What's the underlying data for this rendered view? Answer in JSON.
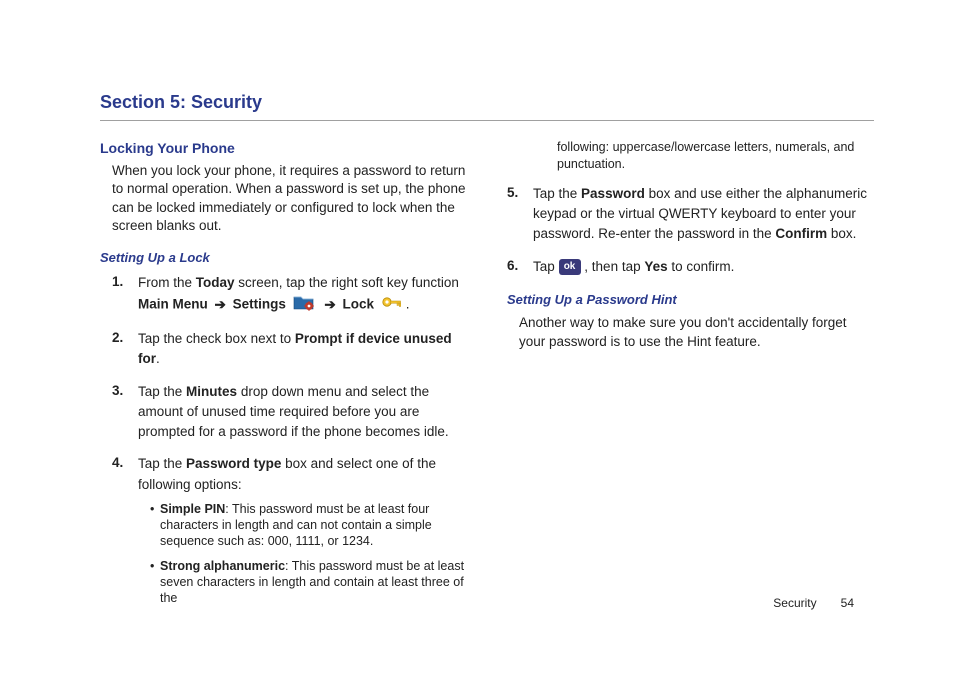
{
  "sectionTitle": "Section 5: Security",
  "footer": {
    "section": "Security",
    "page": "54"
  },
  "left": {
    "h2": "Locking Your Phone",
    "intro": "When you lock your phone, it requires a password to return to normal operation. When a password is set up, the phone can be locked immediately or configured to lock when the screen blanks out.",
    "h3": "Setting Up a Lock",
    "step1_a": "From the ",
    "step1_today": "Today",
    "step1_b": " screen, tap the right soft key function ",
    "step1_main": "Main Menu",
    "step1_arrow1": "➔",
    "step1_settings": "Settings",
    "step1_arrow2": "➔",
    "step1_lock": "Lock",
    "step1_end": ".",
    "step2_a": "Tap the check box next to ",
    "step2_b": "Prompt if device unused for",
    "step2_c": ".",
    "step3_a": "Tap the ",
    "step3_b": "Minutes",
    "step3_c": " drop down menu and select the amount of unused time required before you are prompted for a password if the phone becomes idle.",
    "step4_a": "Tap the ",
    "step4_b": "Password type",
    "step4_c": " box and select one of the following options:",
    "bullet1_a": "Simple PIN",
    "bullet1_b": ": This password must be at least four characters in length and can not contain a simple sequence such as: 000, 1111, or 1234.",
    "bullet2_a": "Strong alphanumeric",
    "bullet2_b": ": This password must be at least seven characters in length and contain at least three of the"
  },
  "right": {
    "cont": "following: uppercase/lowercase letters, numerals, and punctuation.",
    "step5_a": "Tap the ",
    "step5_b": "Password",
    "step5_c": " box and use either the alphanumeric keypad or the virtual QWERTY keyboard to enter your password. Re-enter the password in the ",
    "step5_d": "Confirm",
    "step5_e": " box.",
    "step6_a": "Tap ",
    "step6_ok": "ok",
    "step6_b": ", then tap ",
    "step6_c": "Yes",
    "step6_d": " to confirm.",
    "h3": "Setting Up a Password Hint",
    "hintBody": "Another way to make sure you don't accidentally forget your password is to use the Hint feature."
  },
  "nums": {
    "n1": "1.",
    "n2": "2.",
    "n3": "3.",
    "n4": "4.",
    "n5": "5.",
    "n6": "6."
  },
  "dot": "•"
}
